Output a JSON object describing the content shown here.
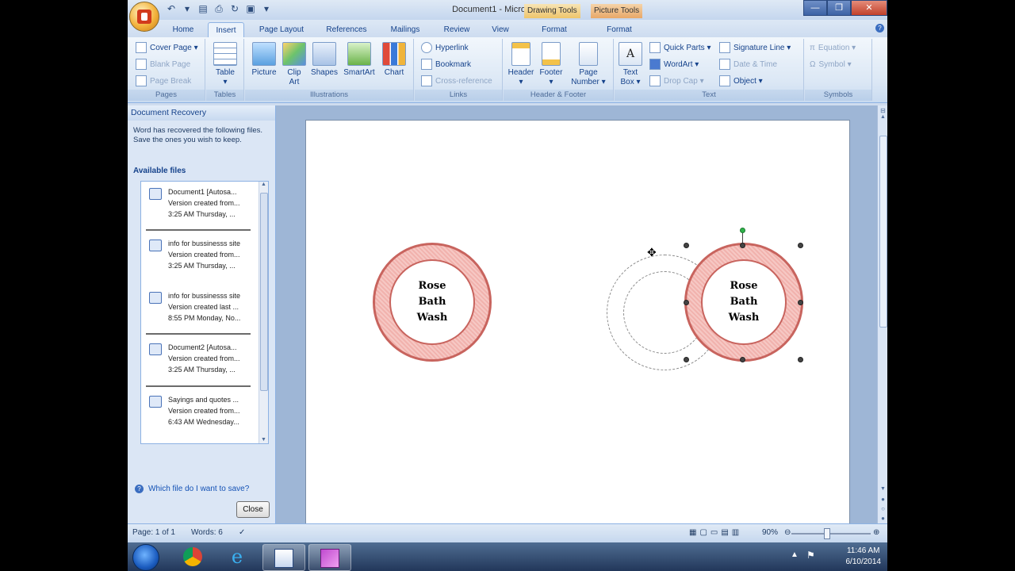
{
  "window": {
    "title": "Document1 - Microsoft Word",
    "context_tabs": {
      "drawing_tools": "Drawing Tools",
      "picture_tools": "Picture Tools"
    },
    "controls": {
      "minimize": "—",
      "maximize": "❐",
      "close": "✕"
    }
  },
  "tabs": [
    {
      "label": "Home"
    },
    {
      "label": "Insert"
    },
    {
      "label": "Page Layout"
    },
    {
      "label": "References"
    },
    {
      "label": "Mailings"
    },
    {
      "label": "Review"
    },
    {
      "label": "View"
    },
    {
      "label": "Format"
    },
    {
      "label": "Format"
    }
  ],
  "active_tab": "Insert",
  "ribbon": {
    "pages": {
      "label": "Pages",
      "cover_page": "Cover Page ▾",
      "blank_page": "Blank Page",
      "page_break": "Page Break"
    },
    "tables": {
      "label": "Tables",
      "table": "Table"
    },
    "illustrations": {
      "label": "Illustrations",
      "picture": "Picture",
      "clip_art": "Clip Art",
      "shapes": "Shapes",
      "smartart": "SmartArt",
      "chart": "Chart"
    },
    "links": {
      "label": "Links",
      "hyperlink": "Hyperlink",
      "bookmark": "Bookmark",
      "cross_reference": "Cross-reference"
    },
    "header_footer": {
      "label": "Header & Footer",
      "header": "Header",
      "footer": "Footer",
      "page_number": "Page Number"
    },
    "text": {
      "label": "Text",
      "text_box": "Text Box",
      "quick_parts": "Quick Parts ▾",
      "wordart": "WordArt ▾",
      "drop_cap": "Drop Cap ▾",
      "signature_line": "Signature Line ▾",
      "date_time": "Date & Time",
      "object": "Object ▾"
    },
    "symbols": {
      "label": "Symbols",
      "equation": "Equation ▾",
      "symbol": "Symbol ▾"
    }
  },
  "recovery_pane": {
    "title": "Document Recovery",
    "message": "Word has recovered the following files.  Save the ones you wish to keep.",
    "available_files_label": "Available files",
    "files": [
      {
        "line1": "Document1  [Autosa...",
        "line2": "Version created from...",
        "line3": "3:25 AM Thursday, ..."
      },
      {
        "line1": "info for bussinesss site",
        "line2": "Version created from...",
        "line3": "3:25 AM Thursday, ..."
      },
      {
        "line1": "info for bussinesss site",
        "line2": "Version created last ...",
        "line3": "8:55 PM Monday, No..."
      },
      {
        "line1": "Document2  [Autosa...",
        "line2": "Version created from...",
        "line3": "3:25 AM Thursday, ..."
      },
      {
        "line1": "Sayings and quotes ...",
        "line2": "Version created from...",
        "line3": "6:43 AM Wednesday..."
      }
    ],
    "help_link": "Which file do I want to save?",
    "close_button": "Close"
  },
  "document": {
    "badge_left": {
      "line1": "Rose",
      "line2": "Bath",
      "line3": "Wash"
    },
    "badge_right": {
      "line1": "Rose",
      "line2": "Bath",
      "line3": "Wash"
    }
  },
  "statusbar": {
    "page": "Page: 1 of 1",
    "words": "Words: 6",
    "zoom": "90%",
    "zoom_percent": 90
  },
  "taskbar": {
    "time": "11:46 AM",
    "date": "6/10/2014"
  },
  "colors": {
    "ribbon_text": "#15428b",
    "badge_ring": "#f1b2ad",
    "badge_border": "#c8645e",
    "handle_green": "#2fb34a"
  }
}
